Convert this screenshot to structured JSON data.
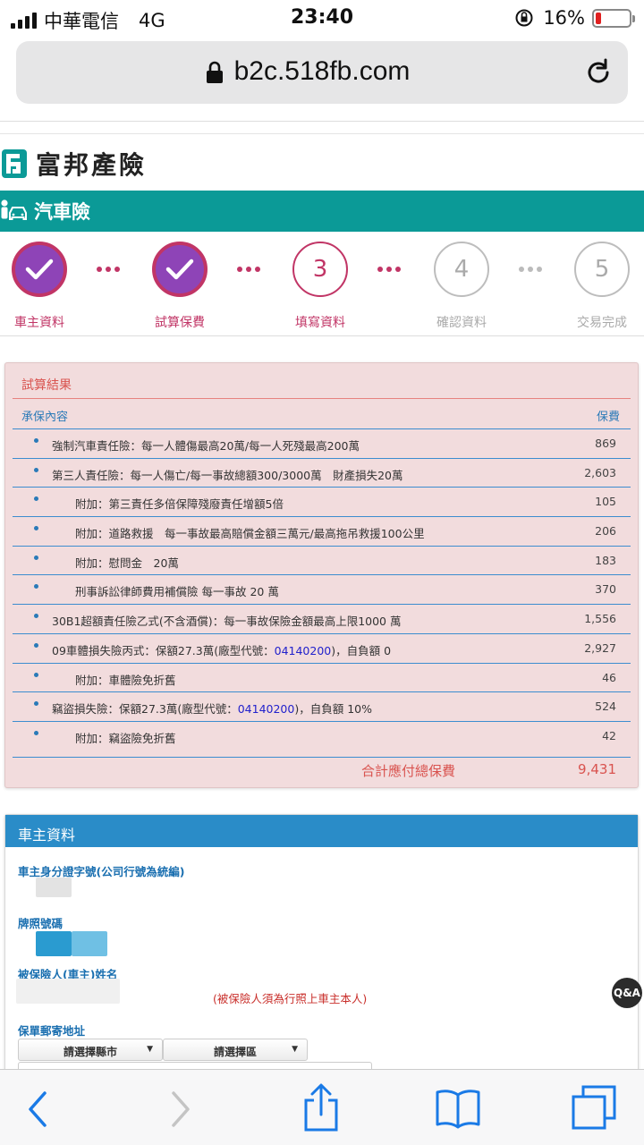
{
  "status_bar": {
    "carrier": "中華電信",
    "network": "4G",
    "time": "23:40",
    "battery": "16%",
    "battery_level": 0.16
  },
  "browser": {
    "url": "b2c.518fb.com"
  },
  "brand": {
    "name": "富邦產險"
  },
  "section": {
    "title": "汽車險"
  },
  "steps": [
    {
      "number": "",
      "label": "車主資料",
      "state": "done"
    },
    {
      "number": "",
      "label": "試算保費",
      "state": "done"
    },
    {
      "number": "3",
      "label": "填寫資料",
      "state": "current"
    },
    {
      "number": "4",
      "label": "確認資料",
      "state": "todo"
    },
    {
      "number": "5",
      "label": "交易完成",
      "state": "todo"
    }
  ],
  "result": {
    "title": "試算結果",
    "col_content": "承保內容",
    "col_premium": "保費",
    "rows": [
      {
        "text": "強制汽車責任險：每一人體傷最高20萬/每一人死殘最高200萬",
        "amount": "869",
        "indent": false
      },
      {
        "text": "第三人責任險：每一人傷亡/每一事故總額300/3000萬　財產損失20萬",
        "amount": "2,603",
        "indent": false
      },
      {
        "text": "附加：第三責任多倍保障殘廢責任增額5倍",
        "amount": "105",
        "indent": true
      },
      {
        "text": "附加：道路救援　每一事故最高賠償金額三萬元/最高拖吊救援100公里",
        "amount": "206",
        "indent": true
      },
      {
        "text": "附加：慰問金　20萬",
        "amount": "183",
        "indent": true
      },
      {
        "text": "刑事訴訟律師費用補償險 每一事故 20 萬",
        "amount": "370",
        "indent": true
      },
      {
        "text": "30B1超額責任險乙式(不含酒償)：每一事故保險金額最高上限1000 萬",
        "amount": "1,556",
        "indent": false
      },
      {
        "text": "09車體損失險丙式：保額27.3萬(廠型代號：",
        "code": "04140200",
        "after": ")，自負額 0",
        "amount": "2,927",
        "indent": false
      },
      {
        "text": "附加：車體險免折舊",
        "amount": "46",
        "indent": true
      },
      {
        "text": "竊盜損失險：保額27.3萬(廠型代號：",
        "code": "04140200",
        "after": ")，自負額 10%",
        "amount": "524",
        "indent": false
      },
      {
        "text": "附加：竊盜險免折舊",
        "amount": "42",
        "indent": true
      }
    ],
    "total_label": "合計應付總保費",
    "total_amount": "9,431"
  },
  "owner": {
    "title": "車主資料",
    "id_label": "車主身分證字號(公司行號為統編)",
    "plate_label": "牌照號碼",
    "name_label": "被保險人(車主)姓名",
    "name_note": "(被保險人須為行照上車主本人)",
    "address_label": "保單郵寄地址",
    "city_select": "請選擇縣市",
    "district_select": "請選擇區"
  },
  "help": {
    "label": "Q&A"
  },
  "colors": {
    "teal": "#0b9a97",
    "purple": "#8e44b7",
    "crimson": "#c13566",
    "blue": "#2a8cc8"
  }
}
